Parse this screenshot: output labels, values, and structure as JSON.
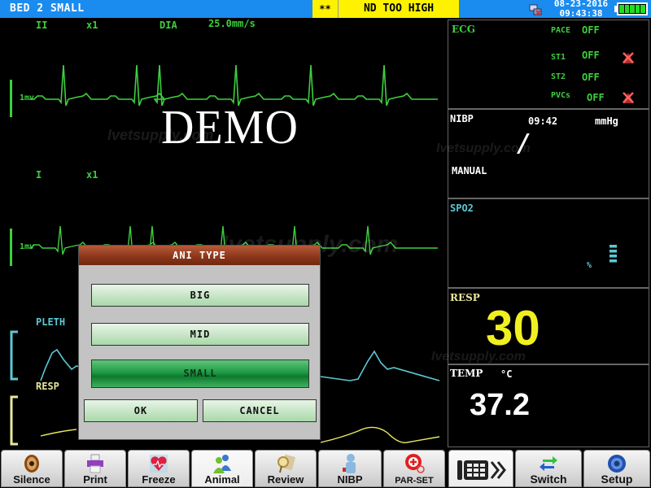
{
  "topbar": {
    "bed": "BED 2  SMALL",
    "alarm_level": "**",
    "alarm_message": "ND TOO HIGH",
    "date": "08-23-2016",
    "time": "09:43:38",
    "battery_level": 1.0
  },
  "waves": {
    "ecg1": {
      "lead": "II",
      "gain": "x1",
      "filter": "DIA",
      "speed": "25.0mm/s",
      "scale": "1mv"
    },
    "ecg2": {
      "lead": "I",
      "gain": "x1",
      "scale": "1mv"
    },
    "pleth": {
      "label": "PLETH"
    },
    "resp": {
      "label": "RESP"
    },
    "demo_overlay": "DEMO",
    "watermark": "Ivetsupply.com"
  },
  "panels": {
    "ecg": {
      "title": "ECG",
      "pace_label": "PACE",
      "pace_value": "OFF",
      "st1_label": "ST1",
      "st1_value": "OFF",
      "st2_label": "ST2",
      "st2_value": "OFF",
      "pvcs_label": "PVCs",
      "pvcs_value": "OFF"
    },
    "nibp": {
      "title": "NIBP",
      "time": "09:42",
      "unit": "mmHg",
      "value": "/",
      "mode": "MANUAL"
    },
    "spo2": {
      "title": "SPO2",
      "unit": "%",
      "value": ""
    },
    "resp": {
      "title": "RESP",
      "value": "30"
    },
    "temp": {
      "title": "TEMP",
      "unit": "°C",
      "value": "37.2"
    }
  },
  "dialog": {
    "title": "ANI TYPE",
    "options": [
      "BIG",
      "MID",
      "SMALL"
    ],
    "selected": "SMALL",
    "ok_label": "OK",
    "cancel_label": "CANCEL"
  },
  "toolbar": {
    "buttons": [
      "Silence",
      "Print",
      "Freeze",
      "Animal",
      "Review",
      "NIBP",
      "PAR-SET",
      "",
      "Switch",
      "Setup"
    ]
  },
  "colors": {
    "topbar": "#1a8cf0",
    "alarm": "#fff200",
    "ecg": "#3ecf3e",
    "spo2": "#5cc8d4",
    "resp": "#f0f020",
    "dialog_title": "#8a3518",
    "selected_option": "#1f9a45"
  }
}
